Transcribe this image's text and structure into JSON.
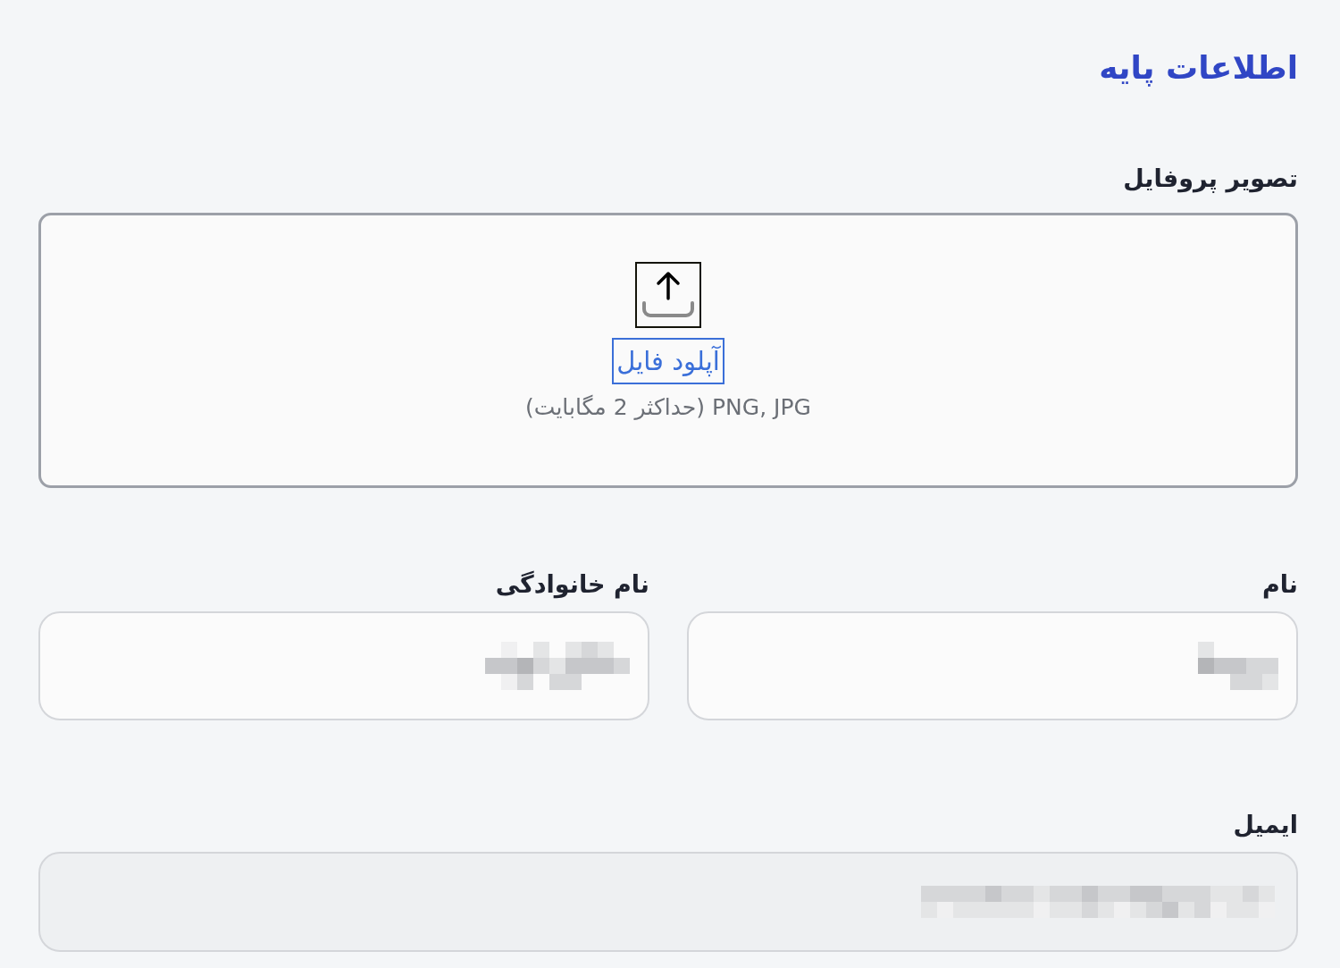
{
  "title": "اطلاعات پایه",
  "profile_picture": {
    "label": "تصویر پروفایل",
    "dropzone": {
      "link": {
        "text": "آپلود فایل",
        "focused": true
      },
      "hint": "PNG, JPG (حداکثر 2 مگابایت)"
    }
  },
  "name_fields": [
    {
      "label": "نام",
      "redacted": true,
      "disabled": false
    },
    {
      "label": "نام خانوادگی",
      "redacted": true,
      "disabled": false
    }
  ],
  "email": {
    "label": "ایمیل",
    "redacted": true,
    "disabled": true
  }
}
